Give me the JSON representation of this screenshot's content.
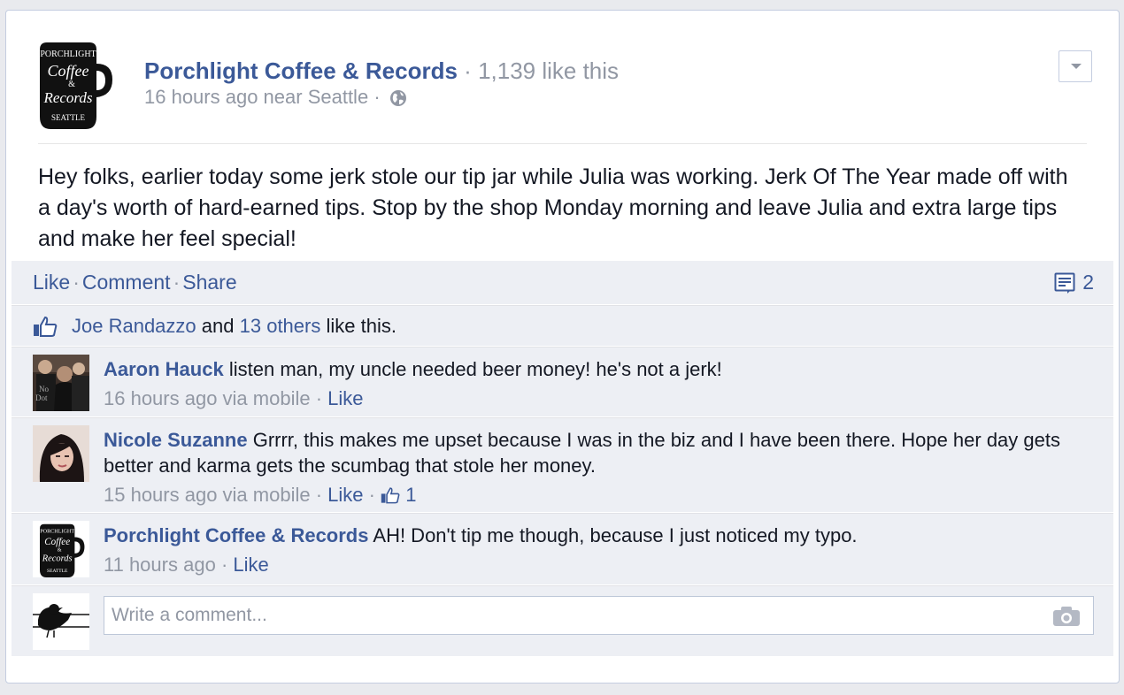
{
  "post": {
    "page_name": "Porchlight Coffee & Records",
    "like_count_text": "1,139 like this",
    "time_text": "16 hours ago near Seattle",
    "message": "Hey folks, earlier today some jerk stole our tip jar while Julia was working. Jerk Of The Year made off with a day's worth of hard-earned tips. Stop by the shop Monday morning and leave Julia and extra large tips and make her feel special!"
  },
  "logo": {
    "line1": "PORCHLIGHT",
    "line2": "Coffee",
    "amp": "&",
    "line3": "Records",
    "line4": "SEATTLE"
  },
  "actions": {
    "like": "Like",
    "comment": "Comment",
    "share": "Share",
    "comment_count": "2"
  },
  "likes": {
    "person": "Joe Randazzo",
    "and": "and",
    "others": "13 others",
    "suffix": "like this."
  },
  "comments": [
    {
      "author": "Aaron Hauck",
      "text": "listen man, my uncle needed beer money! he's not a jerk!",
      "time": "16 hours ago via mobile",
      "like": "Like"
    },
    {
      "author": "Nicole Suzanne",
      "text": "Grrrr, this makes me upset because I was in the biz and I have been there. Hope her day gets better and karma gets the scumbag that stole her money.",
      "time": "15 hours ago via mobile",
      "like": "Like",
      "likes": "1"
    },
    {
      "author": "Porchlight Coffee & Records",
      "text": "AH! Don't tip me though, because I just noticed my typo.",
      "time": "11 hours ago",
      "like": "Like"
    }
  ],
  "composer": {
    "placeholder": "Write a comment..."
  },
  "icons": {
    "globe": "globe-icon",
    "chevron": "chevron-down-icon",
    "comment": "comment-icon",
    "thumbs_up": "thumbs-up-icon",
    "camera": "camera-icon"
  },
  "colors": {
    "link": "#3b5998",
    "muted": "#9197a3",
    "ufi_background": "#edeff4"
  }
}
